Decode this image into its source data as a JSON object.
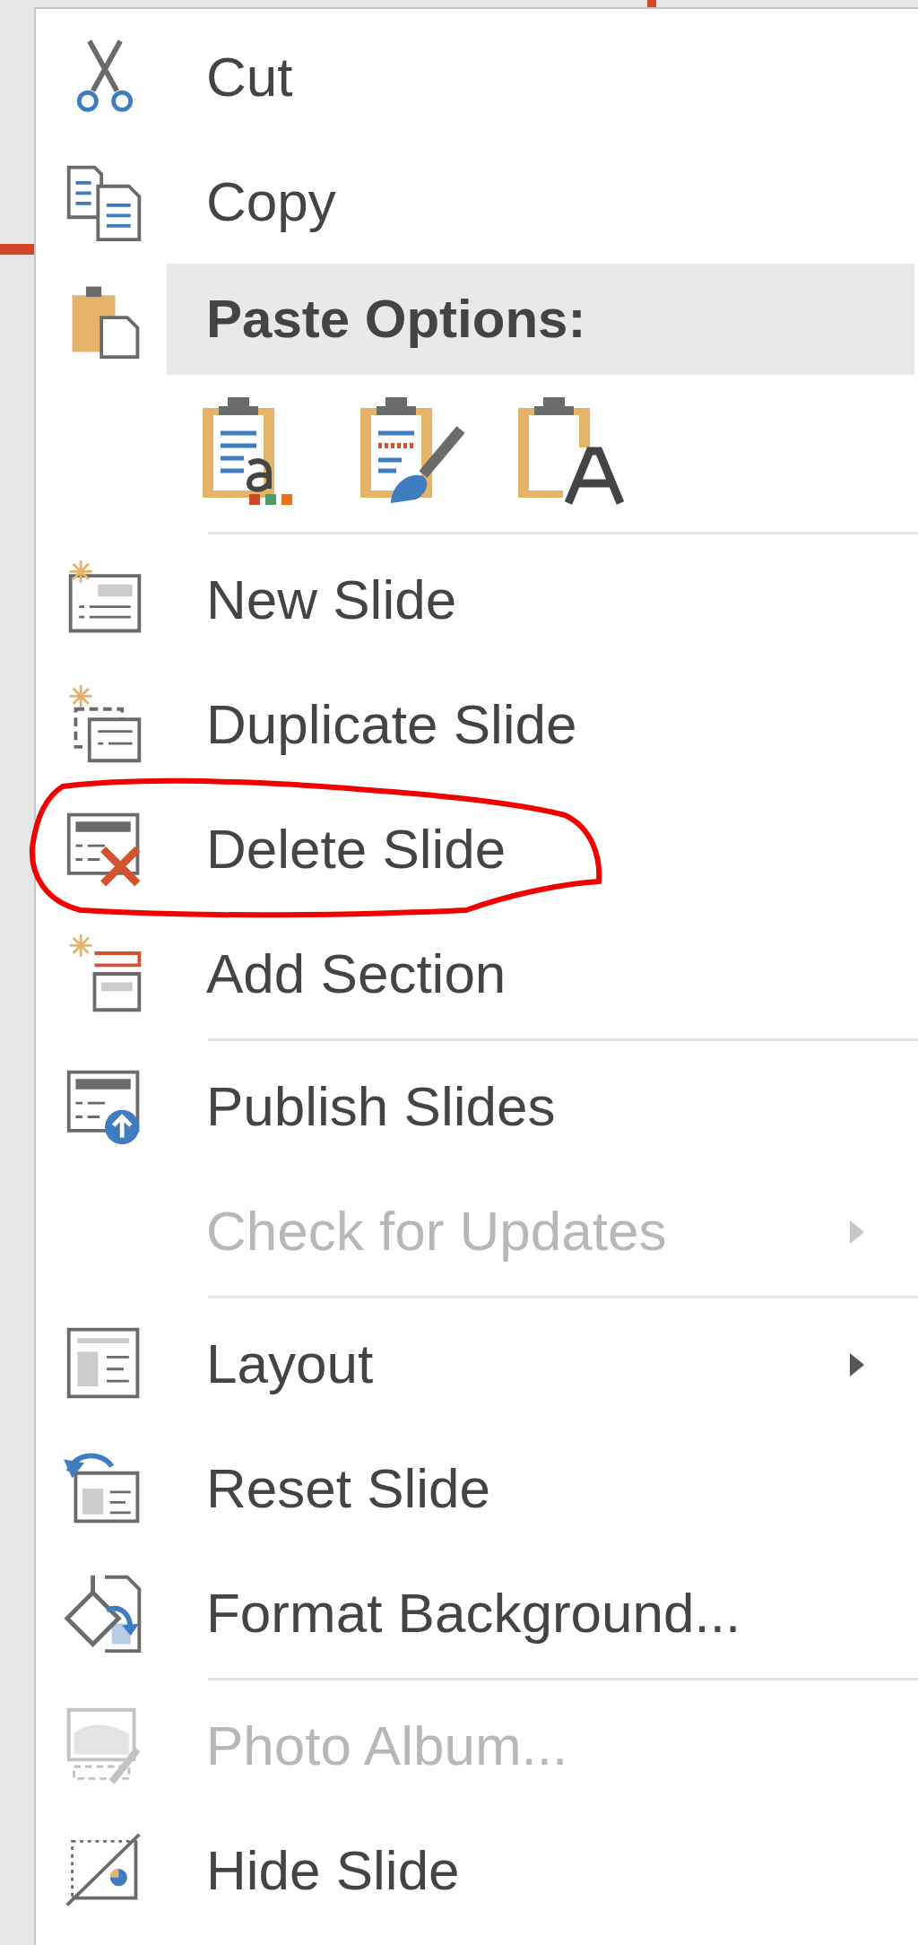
{
  "context_menu": {
    "items": [
      {
        "kind": "command",
        "label": "Cut",
        "disabled": false,
        "submenu": false,
        "circled": false
      },
      {
        "kind": "command",
        "label": "Copy",
        "disabled": false,
        "submenu": false,
        "circled": false
      },
      {
        "kind": "header",
        "label": "Paste Options:"
      },
      {
        "kind": "paste_options",
        "options": [
          {
            "kind": "keep_source"
          },
          {
            "kind": "use_destination"
          },
          {
            "kind": "text_only"
          }
        ]
      },
      {
        "kind": "separator"
      },
      {
        "kind": "command",
        "label": "New Slide",
        "disabled": false,
        "submenu": false,
        "circled": false
      },
      {
        "kind": "command",
        "label": "Duplicate Slide",
        "disabled": false,
        "submenu": false,
        "circled": false
      },
      {
        "kind": "command",
        "label": "Delete Slide",
        "disabled": false,
        "submenu": false,
        "circled": true
      },
      {
        "kind": "command",
        "label": "Add Section",
        "disabled": false,
        "submenu": false,
        "circled": false
      },
      {
        "kind": "separator"
      },
      {
        "kind": "command",
        "label": "Publish Slides",
        "disabled": false,
        "submenu": false,
        "circled": false
      },
      {
        "kind": "command",
        "label": "Check for Updates",
        "disabled": true,
        "submenu": true,
        "circled": false
      },
      {
        "kind": "separator"
      },
      {
        "kind": "command",
        "label": "Layout",
        "disabled": false,
        "submenu": true,
        "circled": false
      },
      {
        "kind": "command",
        "label": "Reset Slide",
        "disabled": false,
        "submenu": false,
        "circled": false
      },
      {
        "kind": "command",
        "label": "Format Background...",
        "disabled": false,
        "submenu": false,
        "circled": false
      },
      {
        "kind": "separator"
      },
      {
        "kind": "command",
        "label": "Photo Album...",
        "disabled": true,
        "submenu": false,
        "circled": false
      },
      {
        "kind": "command",
        "label": "Hide Slide",
        "disabled": false,
        "submenu": false,
        "circled": false
      }
    ]
  }
}
